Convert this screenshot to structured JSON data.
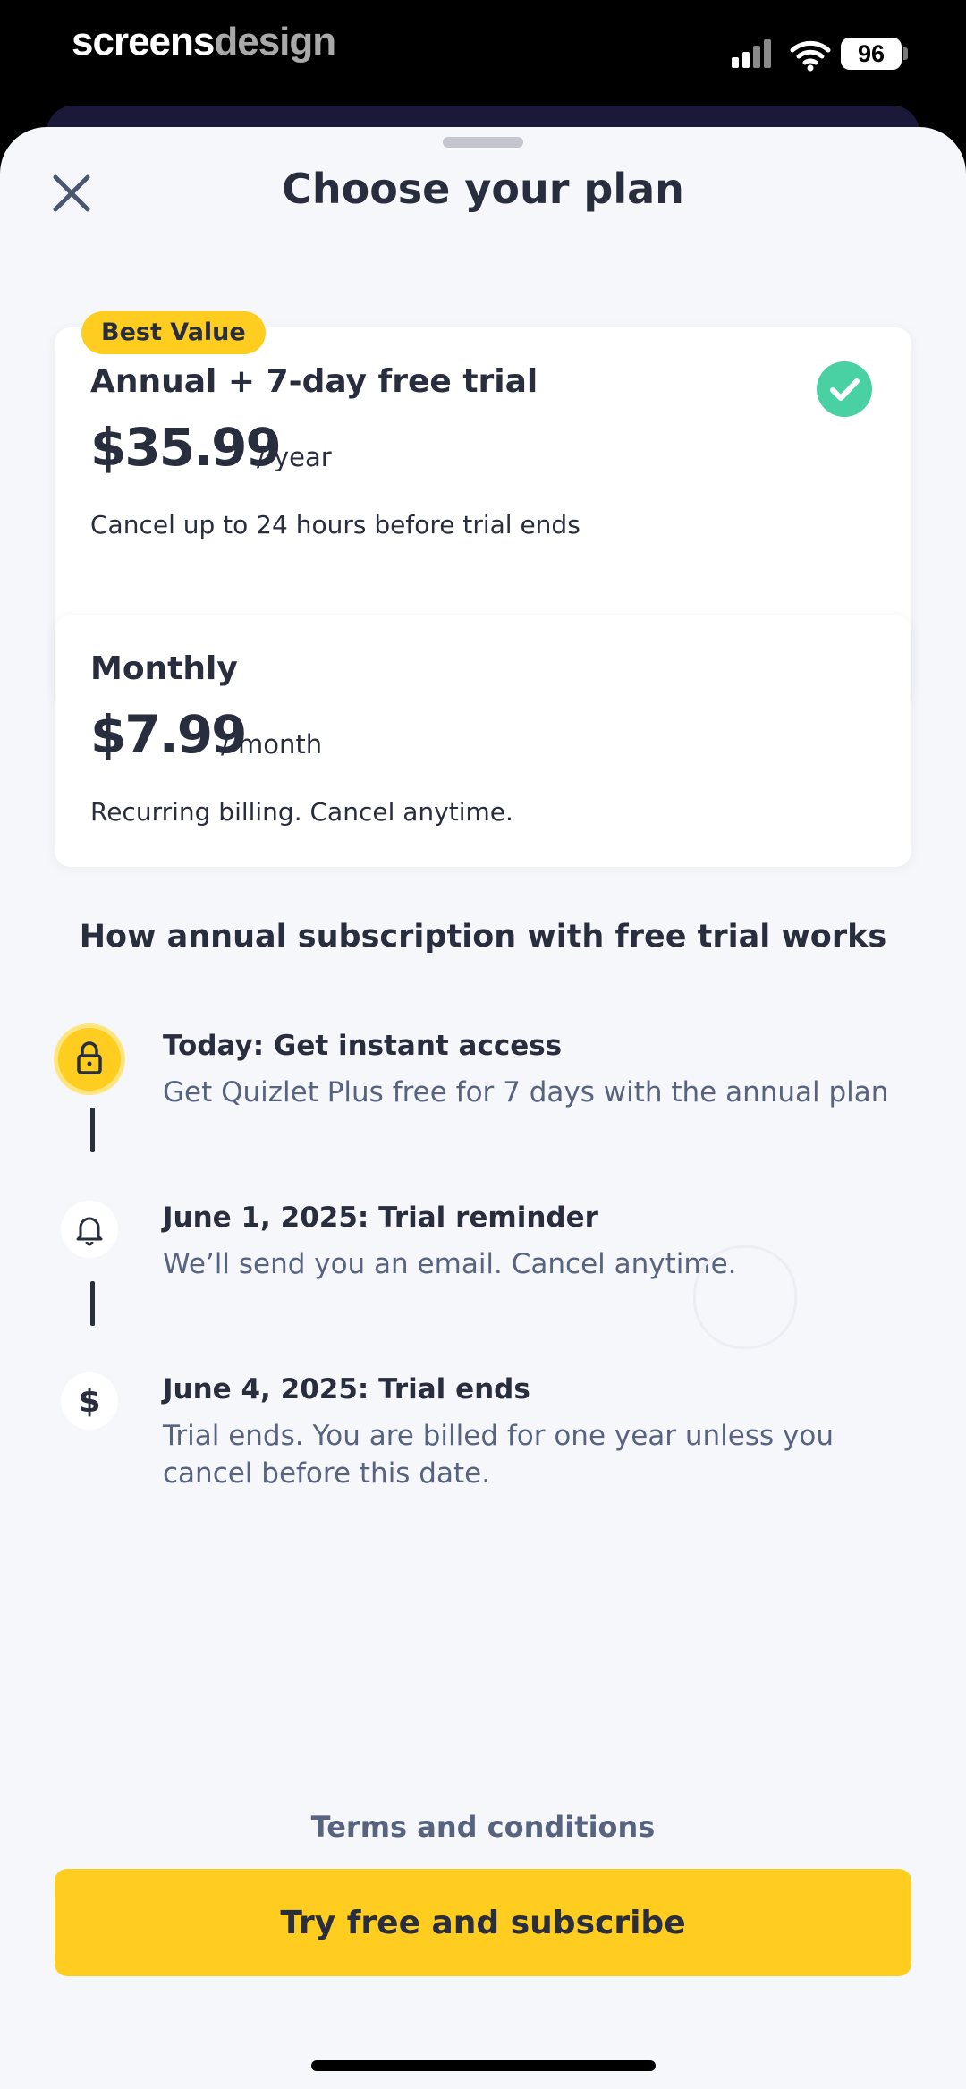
{
  "status_bar": {
    "brand_part1": "screens",
    "brand_part2": "design",
    "battery": "96"
  },
  "header": {
    "title": "Choose your plan"
  },
  "plans": [
    {
      "badge": "Best Value",
      "name": "Annual + 7-day free trial",
      "price": "$35.99",
      "period": "/ year",
      "description": "Cancel up to 24 hours before trial ends",
      "selected": true
    },
    {
      "name": "Monthly",
      "price": "$7.99",
      "period": "/ month",
      "description": "Recurring billing. Cancel anytime.",
      "selected": false
    }
  ],
  "how_it_works": {
    "title": "How annual subscription with free trial works",
    "steps": [
      {
        "icon": "lock-icon",
        "heading": "Today: Get instant access",
        "body": "Get Quizlet Plus free for 7 days with the annual plan"
      },
      {
        "icon": "bell-icon",
        "heading": "June 1, 2025: Trial reminder",
        "body": "We’ll send you an email. Cancel anytime."
      },
      {
        "icon": "dollar-icon",
        "heading": "June 4, 2025: Trial ends",
        "body": "Trial ends. You are billed for one year unless you cancel before this date."
      }
    ]
  },
  "footer": {
    "terms_label": "Terms and conditions",
    "cta_label": "Try free and subscribe"
  },
  "colors": {
    "accent_yellow": "#ffcd1f",
    "selected_border": "#a8b1fb",
    "check_green": "#49d1a3",
    "text_dark": "#282e3e",
    "text_muted": "#586380",
    "sheet_bg": "#f6f7fb"
  }
}
